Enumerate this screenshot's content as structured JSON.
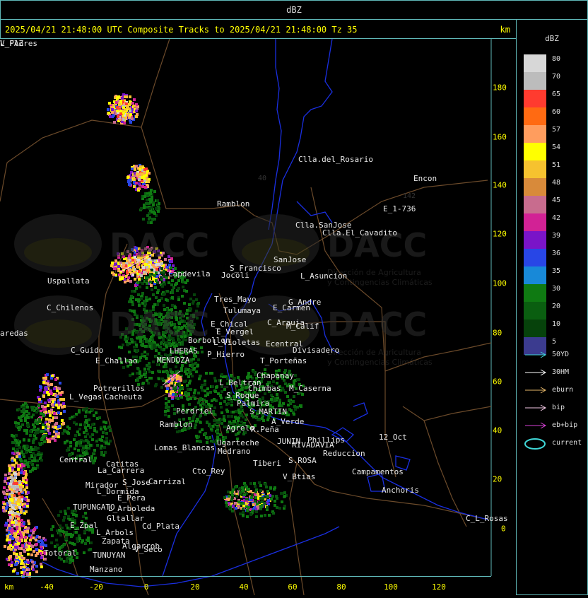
{
  "top_title": "dBZ",
  "header": {
    "title": "2025/04/21 21:48:00 UTC Composite Tracks to 2025/04/21 21:48:00 Tz 35",
    "unit": "km"
  },
  "axes": {
    "x_unit": "km",
    "x_ticks": [
      "-40",
      "-20",
      "0",
      "20",
      "40",
      "60",
      "80",
      "100",
      "120"
    ],
    "y_ticks": [
      "180",
      "160",
      "140",
      "120",
      "100",
      "80",
      "60",
      "40",
      "20",
      "0"
    ]
  },
  "legend": {
    "title": "dBZ",
    "scale": [
      {
        "label": "80",
        "color": "#d7d7d7"
      },
      {
        "label": "70",
        "color": "#bcbcbc"
      },
      {
        "label": "65",
        "color": "#ff3b2f"
      },
      {
        "label": "60",
        "color": "#ff6a12"
      },
      {
        "label": "57",
        "color": "#ff9d5e"
      },
      {
        "label": "54",
        "color": "#ffff00"
      },
      {
        "label": "51",
        "color": "#f6c22f"
      },
      {
        "label": "48",
        "color": "#d88a3a"
      },
      {
        "label": "45",
        "color": "#c86c8e"
      },
      {
        "label": "42",
        "color": "#d22295"
      },
      {
        "label": "39",
        "color": "#7a14c8"
      },
      {
        "label": "36",
        "color": "#2846e6"
      },
      {
        "label": "35",
        "color": "#1889d8"
      },
      {
        "label": "30",
        "color": "#0f7a12"
      },
      {
        "label": "20",
        "color": "#0a5e10"
      },
      {
        "label": "10",
        "color": "#06420b"
      },
      {
        "label": "5",
        "color": "#3b3b8f"
      }
    ],
    "tracks": [
      {
        "label": "50YD",
        "color": "#3fd6d6"
      },
      {
        "label": "30HM",
        "color": "#ffffff"
      },
      {
        "label": "eburn",
        "color": "#e6b76a"
      },
      {
        "label": "bip",
        "color": "#f3c9e6"
      },
      {
        "label": "eb+bip",
        "color": "#d842d8"
      },
      {
        "label": "current",
        "color": "#3fd6d6"
      }
    ]
  },
  "watermark": {
    "brand": "DACC",
    "line1": "Dirección de Agricultura",
    "line2": "y Contingencias Climáticas"
  },
  "places": [
    "Clla.del_Rosario",
    "Encon",
    "E_1-736",
    "Ramblon",
    "Clla.SanJose",
    "Clla.El_Cavadito",
    "Uspallata",
    "S_Francisco",
    "SanJose",
    "L_Asuncion",
    "Capdevila",
    "Jocoli",
    "Tres_Mayo",
    "Tulumaya",
    "G_Andre",
    "E_Carmen",
    "C_Chilenos",
    "C_Arauja",
    "M_Calif",
    "E_Chical",
    "E_Vergel",
    "Borbollon",
    "L_Violetas",
    "Ecentral",
    "Divisadero",
    "aredas",
    "C_Guido",
    "P_Hierro",
    "T_Porteñas",
    "E_Challao",
    "MENDOZA",
    "LHERAS",
    "Chapanay",
    "L_Beltran",
    "Chimbas",
    "M_Caserna",
    "Potrerillos",
    "Cacheuta",
    "L_Vegas",
    "S_Roque",
    "Palmira",
    "S_MARTIN",
    "Perdriel",
    "A_Verde",
    "Ramblon",
    "Agrelo",
    "R.Peña",
    "JUNIN",
    "RIVADAVIA",
    "Phillips",
    "12_Oct",
    "Lomas_Blancas",
    "Ugarteche",
    "Medrano",
    "Reduccion",
    "Tiberi",
    "S.ROSA",
    "Campamentos",
    "Central",
    "Catitas",
    "La_Carrera",
    "Cto_Rey",
    "S_Jose",
    "Carrizal",
    "V_Btias",
    "Anchoris",
    "Mirador",
    "L_Dormida",
    "E_Pera",
    "TUPUNGATO",
    "L_Arboleda",
    "Gltallar",
    "E_Zpal",
    "Cd_Plata",
    "L_Arbols",
    "Zapata",
    "Algarrob",
    "V_Seco",
    "Totoral",
    "TUNUYAN",
    "Manzano",
    "C_L_Rosas",
    "V_Flores",
    "L_PAZ"
  ]
}
